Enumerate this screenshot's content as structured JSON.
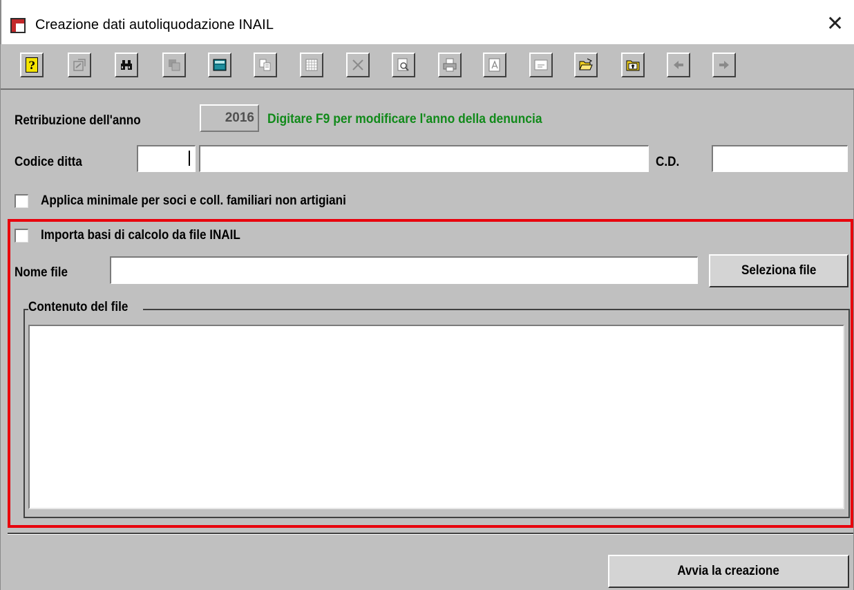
{
  "window": {
    "title": "Creazione dati autoliquodazione INAIL",
    "close_glyph": "✕"
  },
  "toolbar": {
    "buttons": [
      {
        "name": "help-icon",
        "label": "?"
      },
      {
        "name": "properties-icon"
      },
      {
        "name": "binoculars-icon"
      },
      {
        "name": "copy-records-icon"
      },
      {
        "name": "calculator-icon"
      },
      {
        "name": "duplicate-icon"
      },
      {
        "name": "grid-icon"
      },
      {
        "name": "delete-icon"
      },
      {
        "name": "preview-icon"
      },
      {
        "name": "print-icon"
      },
      {
        "name": "pdf-icon"
      },
      {
        "name": "form-icon"
      },
      {
        "name": "open-folder-icon"
      },
      {
        "name": "folder-up-icon"
      },
      {
        "name": "arrow-left-icon"
      },
      {
        "name": "arrow-right-icon"
      }
    ]
  },
  "form": {
    "retribuzione_label": "Retribuzione dell'anno",
    "year_value": "2016",
    "hint": "Digitare F9 per modificare l'anno della denuncia",
    "codice_ditta_label": "Codice ditta",
    "codice_value": "",
    "ditta_name_value": "",
    "cd_label": "C.D.",
    "cd_value": "",
    "applica_minimale_label": "Applica minimale per soci e coll. familiari non artigiani",
    "importa_label": "Importa basi di calcolo da file INAIL",
    "nome_file_label": "Nome file",
    "nome_file_value": "",
    "seleziona_button": "Seleziona file",
    "contenuto_legend": "Contenuto del file",
    "contenuto_value": "",
    "avvia_button": "Avvia la creazione"
  },
  "colors": {
    "hint": "#118a1a",
    "highlight_box": "#e8000c",
    "background": "#c0c0c0"
  }
}
